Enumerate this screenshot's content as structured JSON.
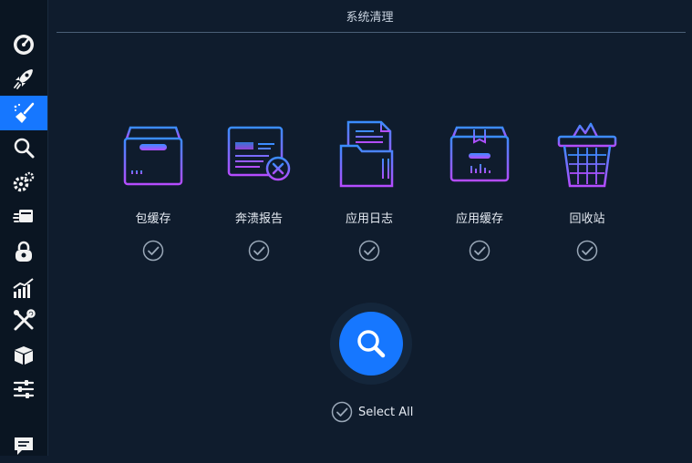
{
  "header": {
    "title": "系统清理"
  },
  "sidebar": {
    "items": [
      {
        "icon": "speedometer-icon"
      },
      {
        "icon": "rocket-icon"
      },
      {
        "icon": "broom-icon",
        "active": true
      },
      {
        "icon": "magnifier-icon"
      },
      {
        "icon": "gears-icon"
      },
      {
        "icon": "cards-icon"
      },
      {
        "icon": "lock-icon"
      },
      {
        "icon": "bar-chart-icon"
      },
      {
        "icon": "tools-icon"
      },
      {
        "icon": "box-icon"
      },
      {
        "icon": "sliders-icon"
      },
      {
        "icon": "message-icon"
      }
    ]
  },
  "categories": [
    {
      "label": "包缓存",
      "icon": "package-box-icon",
      "checked": true
    },
    {
      "label": "奔溃报告",
      "icon": "crash-report-icon",
      "checked": true
    },
    {
      "label": "应用日志",
      "icon": "app-log-folder-icon",
      "checked": true
    },
    {
      "label": "应用缓存",
      "icon": "app-cache-box-icon",
      "checked": true
    },
    {
      "label": "回收站",
      "icon": "recycle-bin-icon",
      "checked": true
    }
  ],
  "scan": {
    "icon": "search-icon"
  },
  "select_all": {
    "label": "Select All",
    "checked": true
  },
  "colors": {
    "background": "#0f1c2d",
    "accent": "#1677ff",
    "icon_gradient_start": "#3a8dff",
    "icon_gradient_end": "#b54cff",
    "check": "#9aa8b8"
  }
}
